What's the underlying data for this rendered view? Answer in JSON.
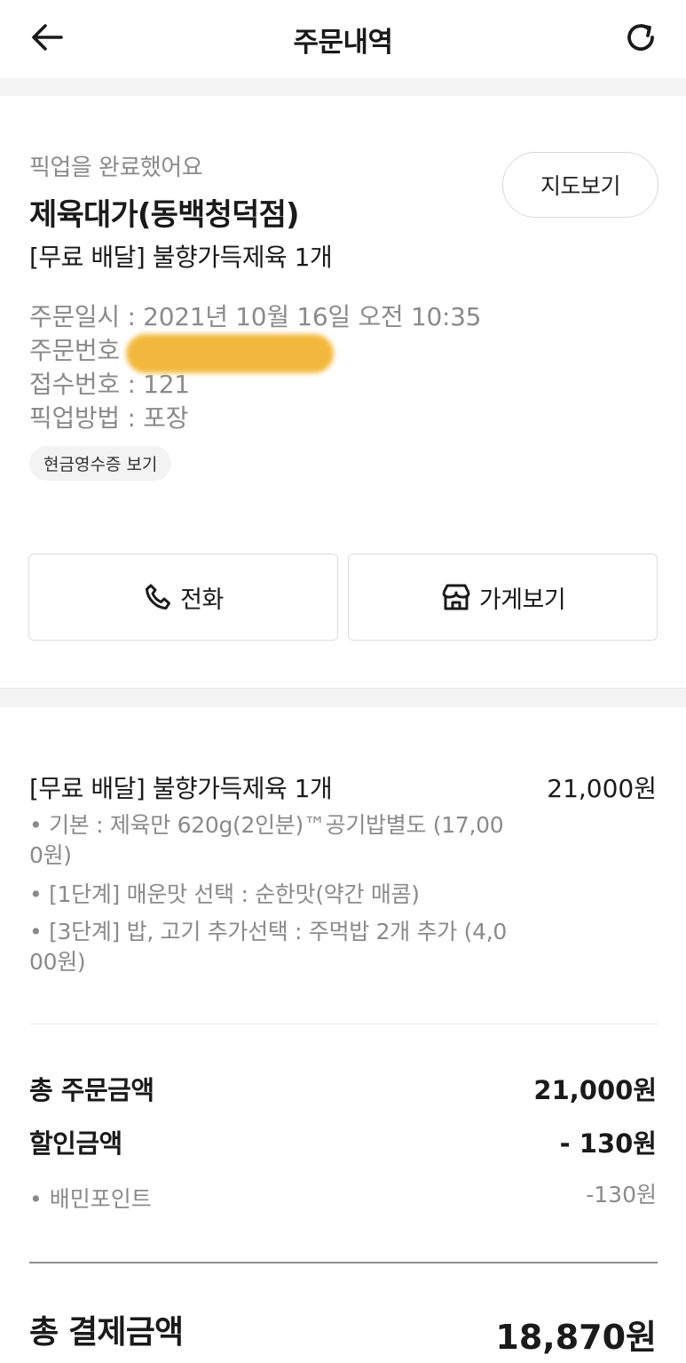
{
  "header": {
    "title": "주문내역",
    "back_icon": "arrow-left-icon",
    "refresh_icon": "refresh-icon"
  },
  "order": {
    "status": "픽업을 완료했어요",
    "store_name": "제육대가(동백청덕점)",
    "menu_summary": "[무료 배달] 불향가득제육 1개",
    "map_button": "지도보기",
    "info": {
      "order_datetime": "주문일시 : 2021년 10월 16일 오전 10:35",
      "order_number_label": "주문번호",
      "receipt_number": "접수번호 : 121",
      "pickup_method": "픽업방법 : 포장"
    },
    "cash_receipt_button": "현금영수증 보기",
    "call_button": "전화",
    "store_button": "가게보기"
  },
  "details": {
    "item_name": "[무료 배달] 불향가득제육 1개",
    "item_price": "21,000원",
    "options": [
      "• 기본 : 제육만 620g(2인분)™공기밥별도 (17,000원)",
      "• [1단계] 매운맛 선택 : 순한맛(약간 매콤)",
      "• [3단계] 밥, 고기 추가선택 : 주먹밥 2개 추가 (4,000원)"
    ]
  },
  "summary": {
    "total_order_label": "총 주문금액",
    "total_order_value": "21,000원",
    "discount_label": "할인금액",
    "discount_value": "- 130원",
    "point_label": "• 배민포인트",
    "point_value": "-130원",
    "payment_label": "총 결제금액",
    "payment_value": "18,870원"
  },
  "colors": {
    "accent_blur": "#f2b533",
    "muted_text": "#8a8a8a",
    "primary_text": "#1a1a1a"
  }
}
